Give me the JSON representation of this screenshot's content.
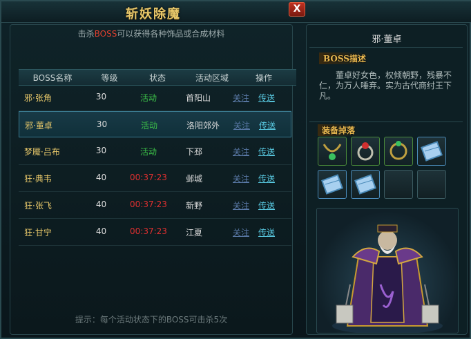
{
  "window": {
    "title": "斩妖除魔",
    "close_label": "X"
  },
  "list_panel": {
    "tip_prefix": "击杀",
    "tip_highlight": "BOSS",
    "tip_suffix": "可以获得各种饰品或合成材料",
    "columns": [
      "BOSS名称",
      "等级",
      "状态",
      "活动区域",
      "操作"
    ],
    "rows": [
      {
        "name": "邪·张角",
        "level": "30",
        "status": "活动",
        "status_type": "active",
        "region": "首阳山",
        "follow": "关注",
        "teleport": "传送"
      },
      {
        "name": "邪·董卓",
        "level": "30",
        "status": "活动",
        "status_type": "active",
        "region": "洛阳郊外",
        "follow": "关注",
        "teleport": "传送"
      },
      {
        "name": "梦魇·吕布",
        "level": "30",
        "status": "活动",
        "status_type": "active",
        "region": "下邳",
        "follow": "关注",
        "teleport": "传送"
      },
      {
        "name": "狂·典韦",
        "level": "40",
        "status": "00:37:23",
        "status_type": "timer",
        "region": "邺城",
        "follow": "关注",
        "teleport": "传送"
      },
      {
        "name": "狂·张飞",
        "level": "40",
        "status": "00:37:23",
        "status_type": "timer",
        "region": "新野",
        "follow": "关注",
        "teleport": "传送"
      },
      {
        "name": "狂·甘宁",
        "level": "40",
        "status": "00:37:23",
        "status_type": "timer",
        "region": "江夏",
        "follow": "关注",
        "teleport": "传送"
      }
    ],
    "selected_row": 1,
    "bottom_tip": "提示：每个活动状态下的BOSS可击杀5次"
  },
  "detail_panel": {
    "boss_name": "邪·董卓",
    "desc_label": "BOSS描述",
    "description": "董卓好女色，权倾朝野，残暴不仁，为万人唾弃。实为古代商纣王下凡。",
    "equip_label": "装备掉落",
    "equipment": [
      {
        "icon": "green-necklace-icon",
        "rarity": "green"
      },
      {
        "icon": "red-gem-ring-icon",
        "rarity": "green"
      },
      {
        "icon": "green-ring-icon",
        "rarity": "green"
      },
      {
        "icon": "blue-scroll-icon",
        "rarity": "blue"
      },
      {
        "icon": "blue-scroll-icon",
        "rarity": "blue"
      },
      {
        "icon": "blue-scroll-icon",
        "rarity": "blue"
      },
      {
        "icon": "empty-slot",
        "rarity": "none"
      },
      {
        "icon": "empty-slot",
        "rarity": "none"
      }
    ]
  },
  "colors": {
    "accent_gold": "#e8c86a",
    "active_green": "#3cc048",
    "timer_red": "#e03030",
    "link_blue": "#58c8e0"
  }
}
